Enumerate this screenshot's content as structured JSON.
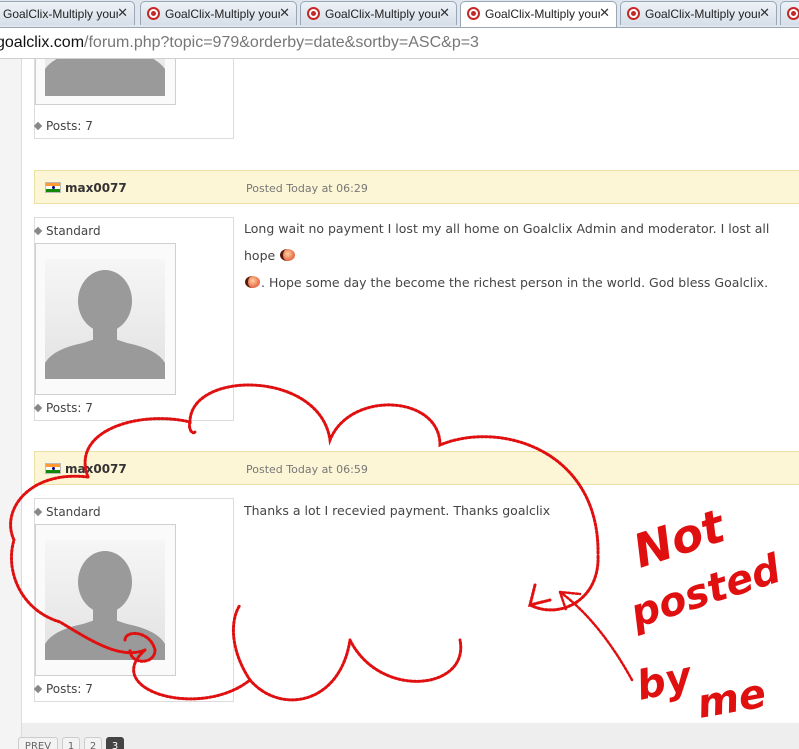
{
  "tabs": [
    {
      "title": "GoalClix-Multiply your E",
      "active": false
    },
    {
      "title": "GoalClix-Multiply your E",
      "active": false
    },
    {
      "title": "GoalClix-Multiply your E",
      "active": false
    },
    {
      "title": "GoalClix-Multiply your E",
      "active": true
    },
    {
      "title": "GoalClix-Multiply your E",
      "active": false
    },
    {
      "title": "",
      "active": false
    }
  ],
  "address": {
    "host": "goalclix.com",
    "path": "/forum.php?topic=979&orderby=date&sortby=ASC&p=3"
  },
  "posts": [
    {
      "posts_label": "Posts: 7"
    },
    {
      "author": "max0077",
      "posted": "Posted Today at 06:29",
      "rank": "Standard",
      "posts_label": "Posts: 7",
      "text_line1": "Long wait no payment I lost my all home on Goalclix Admin and moderator. I lost all hope",
      "text_line2": ". Hope some day the become the richest person in the world. God bless Goalclix."
    },
    {
      "author": "max0077",
      "posted": "Posted Today at 06:59",
      "rank": "Standard",
      "posts_label": "Posts: 7",
      "text": "Thanks a lot I recevied payment. Thanks goalclix"
    }
  ],
  "pager": {
    "prev": "PREV",
    "pages": [
      "1",
      "2",
      "3"
    ],
    "current": "3"
  },
  "annotation": {
    "line1": "Not",
    "line2": "posted",
    "line3": "by",
    "line4": "me",
    "color": "#e01010"
  }
}
